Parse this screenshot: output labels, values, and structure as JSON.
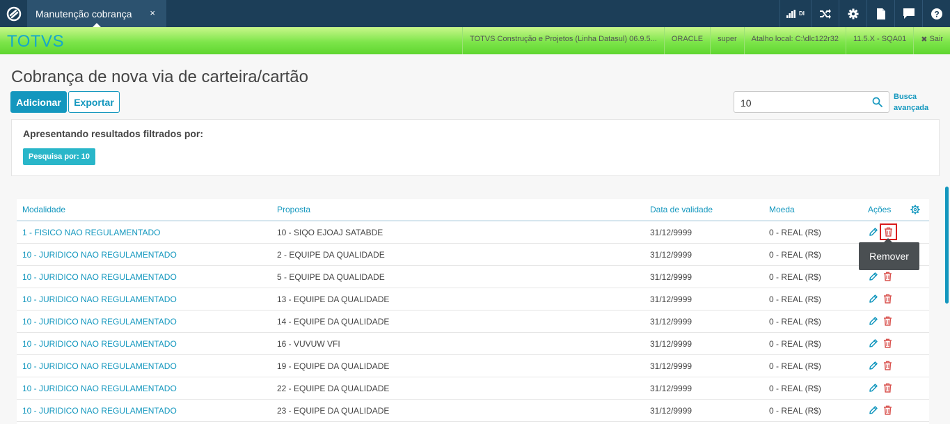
{
  "topbar": {
    "tab_label": "Manutenção cobrança",
    "tab_close": "×",
    "signal_label": "DI"
  },
  "greenbar": {
    "brand": "TOTVS",
    "items": [
      "TOTVS Construção e Projetos (Linha Datasul) 06.9.5...",
      "ORACLE",
      "super",
      "Atalho local: C:\\dlc122r32",
      "11.5.X - SQA01",
      "Sair"
    ],
    "logout_icon": "✖"
  },
  "page": {
    "title": "Cobrança de nova via de carteira/cartão",
    "add_label": "Adicionar",
    "export_label": "Exportar",
    "search_value": "10",
    "advanced_search_line1": "Busca",
    "advanced_search_line2": "avançada"
  },
  "filter": {
    "title": "Apresentando resultados filtrados por:",
    "chip": "Pesquisa por: 10"
  },
  "table": {
    "headers": {
      "modalidade": "Modalidade",
      "proposta": "Proposta",
      "data": "Data de validade",
      "moeda": "Moeda",
      "acoes": "Ações"
    },
    "rows": [
      {
        "modalidade": "1 - FISICO NAO REGULAMENTADO",
        "proposta": "10 - SIQO EJOAJ SATABDE",
        "data": "31/12/9999",
        "moeda": "0 - REAL (R$)"
      },
      {
        "modalidade": "10 - JURIDICO NAO REGULAMENTADO",
        "proposta": "2 - EQUIPE DA QUALIDADE",
        "data": "31/12/9999",
        "moeda": "0 - REAL (R$)"
      },
      {
        "modalidade": "10 - JURIDICO NAO REGULAMENTADO",
        "proposta": "5 - EQUIPE DA QUALIDADE",
        "data": "31/12/9999",
        "moeda": "0 - REAL (R$)"
      },
      {
        "modalidade": "10 - JURIDICO NAO REGULAMENTADO",
        "proposta": "13 - EQUIPE DA QUALIDADE",
        "data": "31/12/9999",
        "moeda": "0 - REAL (R$)"
      },
      {
        "modalidade": "10 - JURIDICO NAO REGULAMENTADO",
        "proposta": "14 - EQUIPE DA QUALIDADE",
        "data": "31/12/9999",
        "moeda": "0 - REAL (R$)"
      },
      {
        "modalidade": "10 - JURIDICO NAO REGULAMENTADO",
        "proposta": "16 - VUVUW VFI",
        "data": "31/12/9999",
        "moeda": "0 - REAL (R$)"
      },
      {
        "modalidade": "10 - JURIDICO NAO REGULAMENTADO",
        "proposta": "19 - EQUIPE DA QUALIDADE",
        "data": "31/12/9999",
        "moeda": "0 - REAL (R$)"
      },
      {
        "modalidade": "10 - JURIDICO NAO REGULAMENTADO",
        "proposta": "22 - EQUIPE DA QUALIDADE",
        "data": "31/12/9999",
        "moeda": "0 - REAL (R$)"
      },
      {
        "modalidade": "10 - JURIDICO NAO REGULAMENTADO",
        "proposta": "23 - EQUIPE DA QUALIDADE",
        "data": "31/12/9999",
        "moeda": "0 - REAL (R$)"
      }
    ]
  },
  "tooltip": {
    "text": "Remover"
  },
  "colors": {
    "accent": "#1397be",
    "topbar": "#1c3e58",
    "delete": "#d9534f",
    "highlight": "#d91c1c"
  },
  "icons": [
    "app-logo-icon",
    "signal-icon",
    "shuffle-icon",
    "gear-icon",
    "document-icon",
    "chat-icon",
    "help-icon",
    "search-icon",
    "edit-icon",
    "trash-icon",
    "settings-icon"
  ]
}
